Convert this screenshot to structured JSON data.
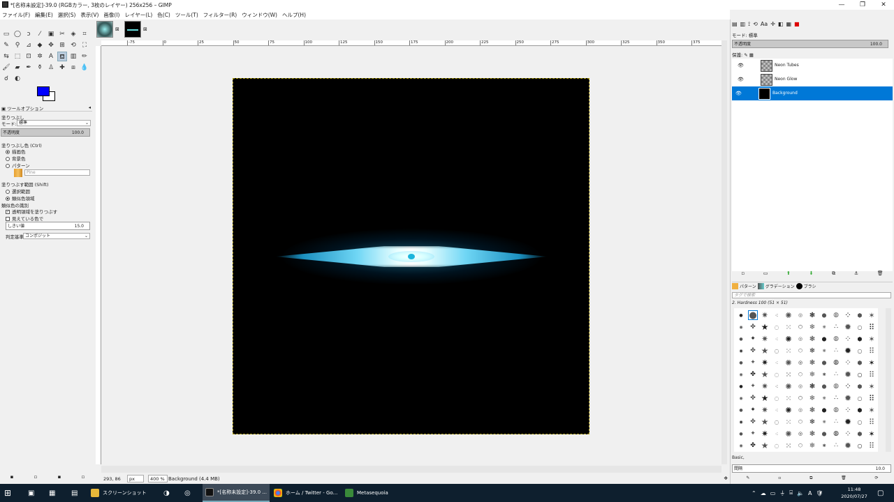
{
  "window": {
    "title": "*[名称未設定]-39.0 (RGBカラー, 3枚のレイヤー) 256x256 – GIMP"
  },
  "menu": [
    "ファイル(F)",
    "編集(E)",
    "選択(S)",
    "表示(V)",
    "画像(I)",
    "レイヤー(L)",
    "色(C)",
    "ツール(T)",
    "フィルター(R)",
    "ウィンドウ(W)",
    "ヘルプ(H)"
  ],
  "tool_options": {
    "tab_label": "ツールオプション",
    "tool_name": "塗りつぶし",
    "mode_label": "モード:",
    "mode_value": "標準",
    "opacity_label": "不透明度",
    "opacity_value": "100.0",
    "fill_type_label": "塗りつぶし色 (Ctrl)",
    "fill_options": [
      "描画色",
      "背景色",
      "パターン"
    ],
    "pattern_name": "Pine",
    "area_label": "塗りつぶす範囲 (Shift)",
    "area_options": [
      "選択範囲",
      "類似色領域"
    ],
    "similar_label": "類似色の識別",
    "check_transparent": "透明領域を塗りつぶす",
    "check_visible": "見えている色で",
    "threshold_label": "しきい値",
    "threshold_value": "15.0",
    "criterion_label": "判定基準:",
    "criterion_value": "コンポジット"
  },
  "statusbar": {
    "coords": "293, 86",
    "unit": "px",
    "zoom": "400 %",
    "info": "Background (4.4 MB)"
  },
  "ruler_ticks": [
    "-75",
    "0",
    "25",
    "50",
    "75",
    "100",
    "125",
    "150",
    "175",
    "200",
    "225",
    "250",
    "275",
    "300",
    "325",
    "350",
    "375"
  ],
  "layers_panel": {
    "mode_label": "モード",
    "mode_value": "標準",
    "opacity_label": "不透明度",
    "opacity_value": "100.0",
    "lock_label": "保護:",
    "layers": [
      {
        "name": "Neon Tubes",
        "selected": false
      },
      {
        "name": "Neon Glow",
        "selected": false
      },
      {
        "name": "Background",
        "selected": true
      }
    ]
  },
  "brushes_panel": {
    "tabs": [
      "パターン",
      "グラデーション",
      "ブラシ"
    ],
    "tag_placeholder": "タグで検索",
    "brush_title": "2. Hardness 100 (51 × 51)",
    "preset": "Basic,",
    "spacing_label": "間隔",
    "spacing_value": "10.0"
  },
  "taskbar": {
    "items": [
      "スクリーンショット",
      "*[名称未設定]-39.0 ...",
      "ホーム / Twitter - Go...",
      "Metasequoia"
    ],
    "time": "11:48",
    "date": "2020/07/27"
  },
  "colors": {
    "foreground": "#0000ff",
    "background": "#ffffff",
    "selection": "#0078d7",
    "glow": "#6fd6f5"
  }
}
